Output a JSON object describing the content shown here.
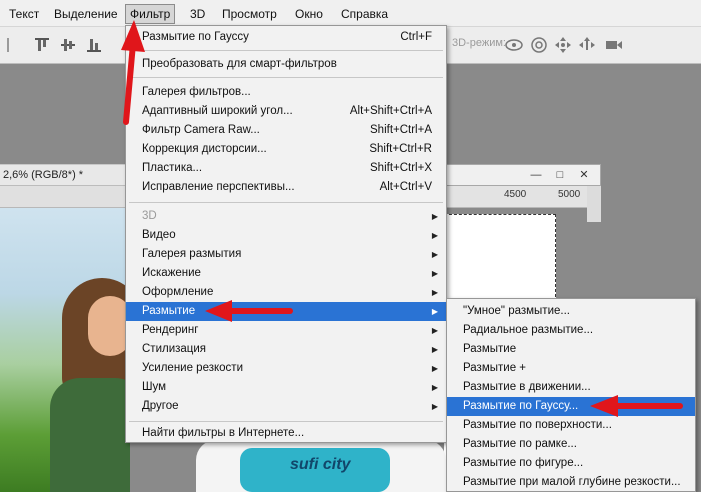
{
  "menubar": {
    "items": [
      {
        "label": "Текст"
      },
      {
        "label": "Выделение"
      },
      {
        "label": "Фильтр",
        "open": true
      },
      {
        "label": "3D"
      },
      {
        "label": "Просмотр"
      },
      {
        "label": "Окно"
      },
      {
        "label": "Справка"
      }
    ]
  },
  "optionsbar": {
    "mode_3d_label": "3D-режим:"
  },
  "document": {
    "tab_title": "2,6% (RGB/8*) *",
    "ruler_labels": [
      "4500",
      "5000"
    ],
    "shirt_print_text": "sufi city"
  },
  "filter_menu": {
    "last_filter": {
      "label": "Размытие по Гауссу",
      "shortcut": "Ctrl+F"
    },
    "smart_filters": {
      "label": "Преобразовать для смарт-фильтров"
    },
    "items": [
      {
        "label": "Галерея фильтров...",
        "shortcut": ""
      },
      {
        "label": "Адаптивный широкий угол...",
        "shortcut": "Alt+Shift+Ctrl+A"
      },
      {
        "label": "Фильтр Camera Raw...",
        "shortcut": "Shift+Ctrl+A"
      },
      {
        "label": "Коррекция дисторсии...",
        "shortcut": "Shift+Ctrl+R"
      },
      {
        "label": "Пластика...",
        "shortcut": "Shift+Ctrl+X"
      },
      {
        "label": "Исправление перспективы...",
        "shortcut": "Alt+Ctrl+V"
      }
    ],
    "submenus": [
      {
        "label": "3D",
        "disabled": true
      },
      {
        "label": "Видео"
      },
      {
        "label": "Галерея размытия"
      },
      {
        "label": "Искажение"
      },
      {
        "label": "Оформление"
      },
      {
        "label": "Размытие",
        "highlighted": true
      },
      {
        "label": "Рендеринг"
      },
      {
        "label": "Стилизация"
      },
      {
        "label": "Усиление резкости"
      },
      {
        "label": "Шум"
      },
      {
        "label": "Другое"
      }
    ],
    "browse_online": {
      "label": "Найти фильтры в Интернете..."
    }
  },
  "blur_submenu": {
    "items": [
      {
        "label": "\"Умное\" размытие..."
      },
      {
        "label": "Радиальное размытие..."
      },
      {
        "label": "Размытие"
      },
      {
        "label": "Размытие +"
      },
      {
        "label": "Размытие в движении..."
      },
      {
        "label": "Размытие по Гауссу...",
        "highlighted": true
      },
      {
        "label": "Размытие по поверхности..."
      },
      {
        "label": "Размытие по рамке..."
      },
      {
        "label": "Размытие по фигуре..."
      },
      {
        "label": "Размытие при малой глубине резкости..."
      }
    ]
  },
  "colors": {
    "highlight": "#2a73d4",
    "annotation_arrow": "#e0161b"
  },
  "icons": [
    "align-top-icon",
    "align-vcenter-icon",
    "align-bottom-icon",
    "orbit-3d-icon",
    "roll-3d-icon",
    "pan-3d-icon",
    "slide-3d-icon",
    "video-camera-icon",
    "chevron-right-icon"
  ]
}
